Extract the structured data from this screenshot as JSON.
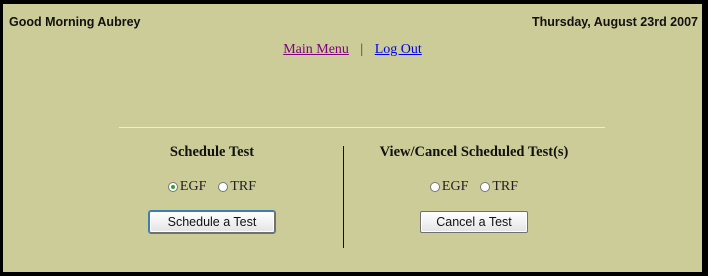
{
  "header": {
    "greeting": "Good Morning Aubrey",
    "date": "Thursday, August 23rd 2007"
  },
  "nav": {
    "main_menu": "Main Menu",
    "separator": "|",
    "log_out": "Log Out"
  },
  "schedule": {
    "title": "Schedule Test",
    "options": [
      "EGF",
      "TRF"
    ],
    "selected": "EGF",
    "button": "Schedule a Test"
  },
  "cancel": {
    "title": "View/Cancel Scheduled Test(s)",
    "options": [
      "EGF",
      "TRF"
    ],
    "selected": null,
    "button": "Cancel a Test"
  },
  "colors": {
    "background": "#cccc99",
    "visited_link": "#800080",
    "link": "#0000ee",
    "radio_selected": "#3c9a3c"
  }
}
